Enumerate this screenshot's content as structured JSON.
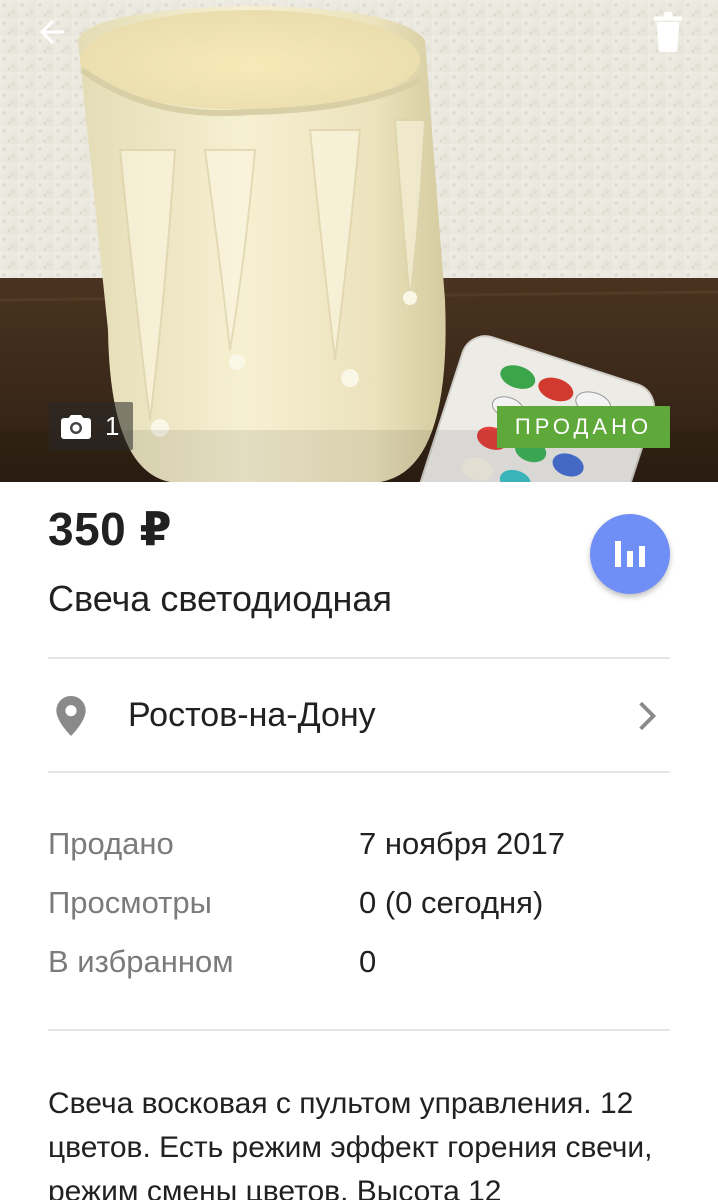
{
  "photo": {
    "count": "1",
    "status_badge": "ПРОДАНО"
  },
  "icons": {
    "back": "arrow-back-icon",
    "delete": "trash-icon",
    "camera": "camera-icon",
    "stats": "bar-chart-icon",
    "location": "location-pin-icon",
    "chevron": "chevron-right-icon"
  },
  "listing": {
    "price": "350 ₽",
    "title": "Свеча светодиодная"
  },
  "location": {
    "city": "Ростов-на-Дону"
  },
  "info": {
    "sold_label": "Продано",
    "sold_value": "7 ноября 2017",
    "views_label": "Просмотры",
    "views_value": "0 (0 сегодня)",
    "favorites_label": "В избранном",
    "favorites_value": "0"
  },
  "description": {
    "text": "Свеча восковая с пультом управления. 12 цветов. Есть режим эффект горения свечи, режим смены цветов. Высота 12"
  },
  "colors": {
    "sold_badge": "#5fa83a",
    "fab": "#6f8ff7",
    "divider": "#e6e6e6",
    "label_text": "#7b7b7b"
  }
}
